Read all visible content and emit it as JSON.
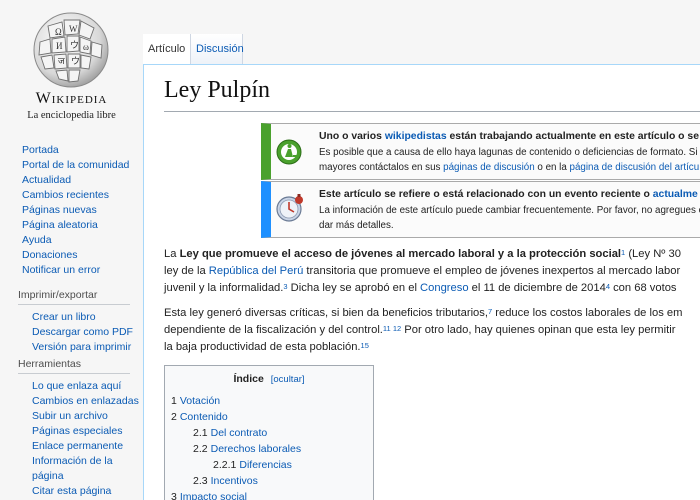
{
  "logo": {
    "wordmark": "Wikipedia",
    "tagline": "La enciclopedia libre"
  },
  "sidebar": {
    "navigation": [
      "Portada",
      "Portal de la comunidad",
      "Actualidad",
      "Cambios recientes",
      "Páginas nuevas",
      "Página aleatoria",
      "Ayuda",
      "Donaciones",
      "Notificar un error"
    ],
    "print_heading": "Imprimir/exportar",
    "print_items": [
      "Crear un libro",
      "Descargar como PDF",
      "Versión para imprimir"
    ],
    "tools_heading": "Herramientas",
    "tools_items": [
      "Lo que enlaza aquí",
      "Cambios en enlazadas",
      "Subir un archivo",
      "Páginas especiales",
      "Enlace permanente",
      "Información de la página",
      "Citar esta página"
    ]
  },
  "tabs": {
    "article": "Artículo",
    "talk": "Discusión"
  },
  "page": {
    "title": "Ley Pulpín"
  },
  "notices": {
    "work": {
      "line1_pre": "Uno o varios ",
      "line1_link": "wikipedistas",
      "line1_post": " están trabajando actualmente en este artículo o se",
      "line2": "Es posible que a causa de ello haya lagunas de contenido o deficiencias de formato. Si",
      "line3_pre": "mayores contáctalos en sus ",
      "line3_link1": "páginas de discusión",
      "line3_mid": " o en la ",
      "line3_link2": "página de discusión del artícu"
    },
    "current": {
      "line1_pre": "Este artículo se refiere o está relacionado con un evento reciente o ",
      "line1_link": "actualme",
      "line2": "La información de este artículo puede cambiar frecuentemente. Por favor, no agregues c",
      "line3": "dar más detalles."
    }
  },
  "body": {
    "p1": {
      "t1": "La ",
      "b1": "Ley que promueve el acceso de jóvenes al mercado laboral y a la protección social",
      "s1": "1",
      "t2": " (Ley Nº 30",
      "t3": "ley de la ",
      "l1": "República del Perú",
      "t4": " transitoria que promueve el empleo de jóvenes inexpertos al mercado labor",
      "t5": "juvenil y la informalidad.",
      "s2": "3",
      "t6": " Dicha ley se aprobó en el ",
      "l2": "Congreso",
      "t7": " el 11 de diciembre de 2014",
      "s3": "4",
      "t8": " con 68 votos"
    },
    "p2": {
      "t1": "Esta ley generó diversas críticas, si bien da beneficios tributarios,",
      "s1": "7",
      "t2": " reduce los costos laborales de los em",
      "t3": "dependiente de la fiscalización y del control.",
      "s2": "11",
      "s3": "12",
      "t4": " Por otro lado, hay quienes opinan que esta ley permitir",
      "t5": "la baja productividad de esta población.",
      "s4": "15"
    }
  },
  "toc": {
    "title": "Índice",
    "toggle": "[ocultar]",
    "items": [
      {
        "num": "1",
        "text": "Votación"
      },
      {
        "num": "2",
        "text": "Contenido"
      },
      {
        "num": "2.1",
        "text": "Del contrato"
      },
      {
        "num": "2.2",
        "text": "Derechos laborales"
      },
      {
        "num": "2.2.1",
        "text": "Diferencias"
      },
      {
        "num": "2.3",
        "text": "Incentivos"
      },
      {
        "num": "3",
        "text": "Impacto social"
      }
    ]
  },
  "colors": {
    "link": "#0b5bb4",
    "work_notice_accent": "#4aa12d",
    "current_notice_accent": "#1e90ff"
  }
}
